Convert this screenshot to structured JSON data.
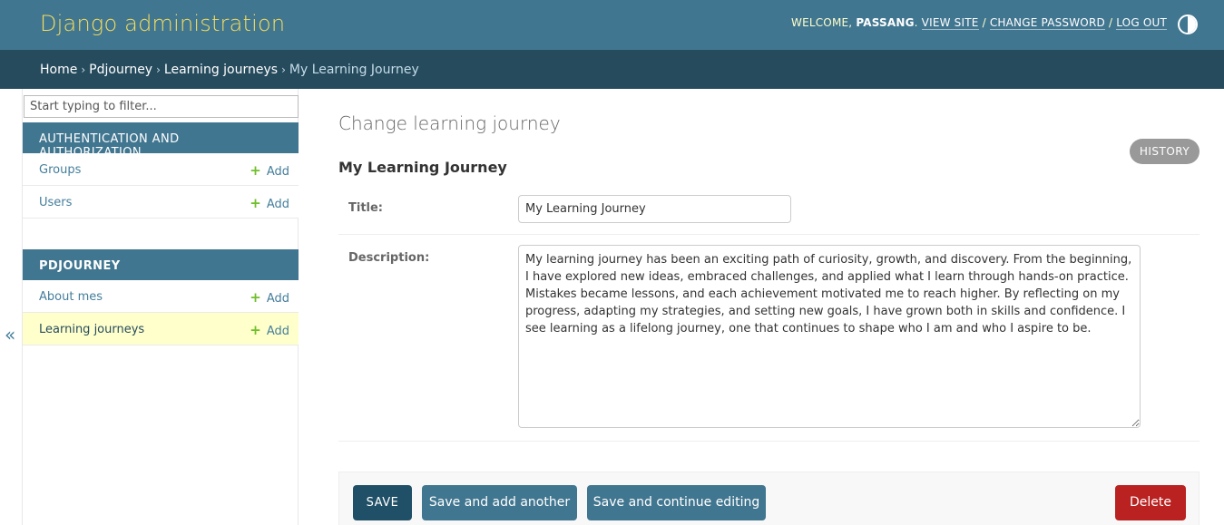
{
  "header": {
    "brand": "Django administration",
    "welcome": "WELCOME,",
    "username": "PASSANG",
    "view_site": "VIEW SITE",
    "change_password": "CHANGE PASSWORD",
    "log_out": "LOG OUT",
    "separator": "/"
  },
  "breadcrumbs": {
    "home": "Home",
    "app": "Pdjourney",
    "model": "Learning journeys",
    "current": "My Learning Journey",
    "separator": "›"
  },
  "sidebar": {
    "filter_placeholder": "Start typing to filter...",
    "collapse_glyph": "«",
    "apps": [
      {
        "caption": "AUTHENTICATION AND AUTHORIZATION",
        "models": [
          {
            "name": "Groups",
            "add": "Add"
          },
          {
            "name": "Users",
            "add": "Add"
          }
        ]
      },
      {
        "caption": "PDJOURNEY",
        "models": [
          {
            "name": "About mes",
            "add": "Add"
          },
          {
            "name": "Learning journeys",
            "add": "Add"
          }
        ]
      }
    ]
  },
  "content": {
    "title": "Change learning journey",
    "history": "HISTORY",
    "object_name": "My Learning Journey",
    "fields": {
      "title_label": "Title:",
      "title_value": "My Learning Journey",
      "description_label": "Description:",
      "description_value": "My learning journey has been an exciting path of curiosity, growth, and discovery. From the beginning, I have explored new ideas, embraced challenges, and applied what I learn through hands-on practice. Mistakes became lessons, and each achievement motivated me to reach higher. By reflecting on my progress, adapting my strategies, and setting new goals, I have grown both in skills and confidence. I see learning as a lifelong journey, one that continues to shape who I am and who I aspire to be."
    },
    "buttons": {
      "save": "SAVE",
      "save_add_another": "Save and add another",
      "save_continue": "Save and continue editing",
      "delete": "Delete"
    }
  },
  "colors": {
    "header_bg": "#417690",
    "breadcrumbs_bg": "#264b5d",
    "brand": "#f5dd5d",
    "accent": "#417690",
    "save_bg": "#205067",
    "delete_bg": "#ba2121",
    "active_row": "#ffffcc"
  },
  "icons": {
    "theme_toggle": "half-circle-contrast-icon",
    "add": "plus-icon"
  }
}
